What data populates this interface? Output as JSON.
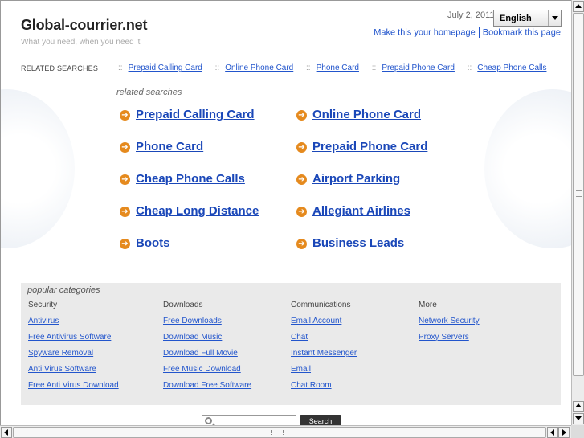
{
  "header": {
    "site_title": "Global-courrier.net",
    "tagline": "What you need, when you need it",
    "date": "July 2, 2011",
    "language": "English",
    "homepage_link": "Make this your homepage",
    "bookmark_link": "Bookmark this page"
  },
  "related_bar": {
    "label": "RELATED SEARCHES",
    "separator": "::",
    "links": [
      "Prepaid Calling Card",
      "Online Phone Card",
      "Phone Card",
      "Prepaid Phone Card",
      "Cheap Phone Calls"
    ]
  },
  "related_searches": {
    "title": "related searches",
    "left": [
      "Prepaid Calling Card",
      "Phone Card",
      "Cheap Phone Calls",
      "Cheap Long Distance",
      "Boots"
    ],
    "right": [
      "Online Phone Card",
      "Prepaid Phone Card",
      "Airport Parking",
      "Allegiant Airlines",
      "Business Leads"
    ]
  },
  "popular": {
    "title": "popular categories",
    "columns": [
      {
        "head": "Security",
        "links": [
          "Antivirus",
          "Free Antivirus Software",
          "Spyware Removal",
          "Anti Virus Software",
          "Free Anti Virus Download"
        ]
      },
      {
        "head": "Downloads",
        "links": [
          "Free Downloads",
          "Download Music",
          "Download Full Movie",
          "Free Music Download",
          "Download Free Software"
        ]
      },
      {
        "head": "Communications",
        "links": [
          "Email Account",
          "Chat",
          "Instant Messenger",
          "Email",
          "Chat Room"
        ]
      },
      {
        "head": "More",
        "links": [
          "Network Security",
          "Proxy Servers"
        ]
      }
    ]
  },
  "search": {
    "value": "",
    "button": "Search"
  },
  "colors": {
    "link": "#2255cc",
    "bullet": "#e58a1e",
    "panel": "#eaeaea"
  }
}
